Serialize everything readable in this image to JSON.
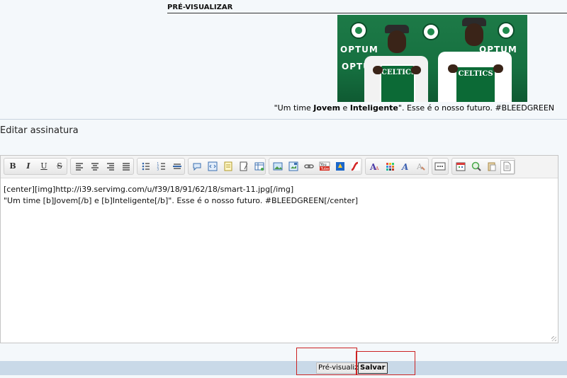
{
  "preview": {
    "header": "PRÉ-VISUALIZAR",
    "image": {
      "banner_word": "OPTUM",
      "logo_text": "celtics",
      "jersey_text": "CELTICS",
      "description_icon": "photo-two-players-celtics-jerseys"
    },
    "caption": {
      "part1": "\"Um time ",
      "bold1": "Jovem",
      "part2": " e ",
      "bold2": "Inteligente",
      "part3": "\". Esse é o nosso futuro. #BLEEDGREEN"
    }
  },
  "edit": {
    "title": "Editar assinatura"
  },
  "toolbar": {
    "bold": "B",
    "italic": "I",
    "underline": "U",
    "strike": "S"
  },
  "editor": {
    "line1": "[center][img]http://i39.servimg.com/u/f39/18/91/62/18/smart-11.jpg[/img]",
    "line2": "\"Um time [b]Jovem[/b] e [b]Inteligente[/b]\". Esse é o nosso futuro. #BLEEDGREEN[/center]"
  },
  "buttons": {
    "preview": "Pré-visualizar",
    "save": "Salvar"
  },
  "colors": {
    "highlight": "#cc2222",
    "celtics_green": "#0c6a36",
    "bottom_bar": "#c9d9e8"
  }
}
